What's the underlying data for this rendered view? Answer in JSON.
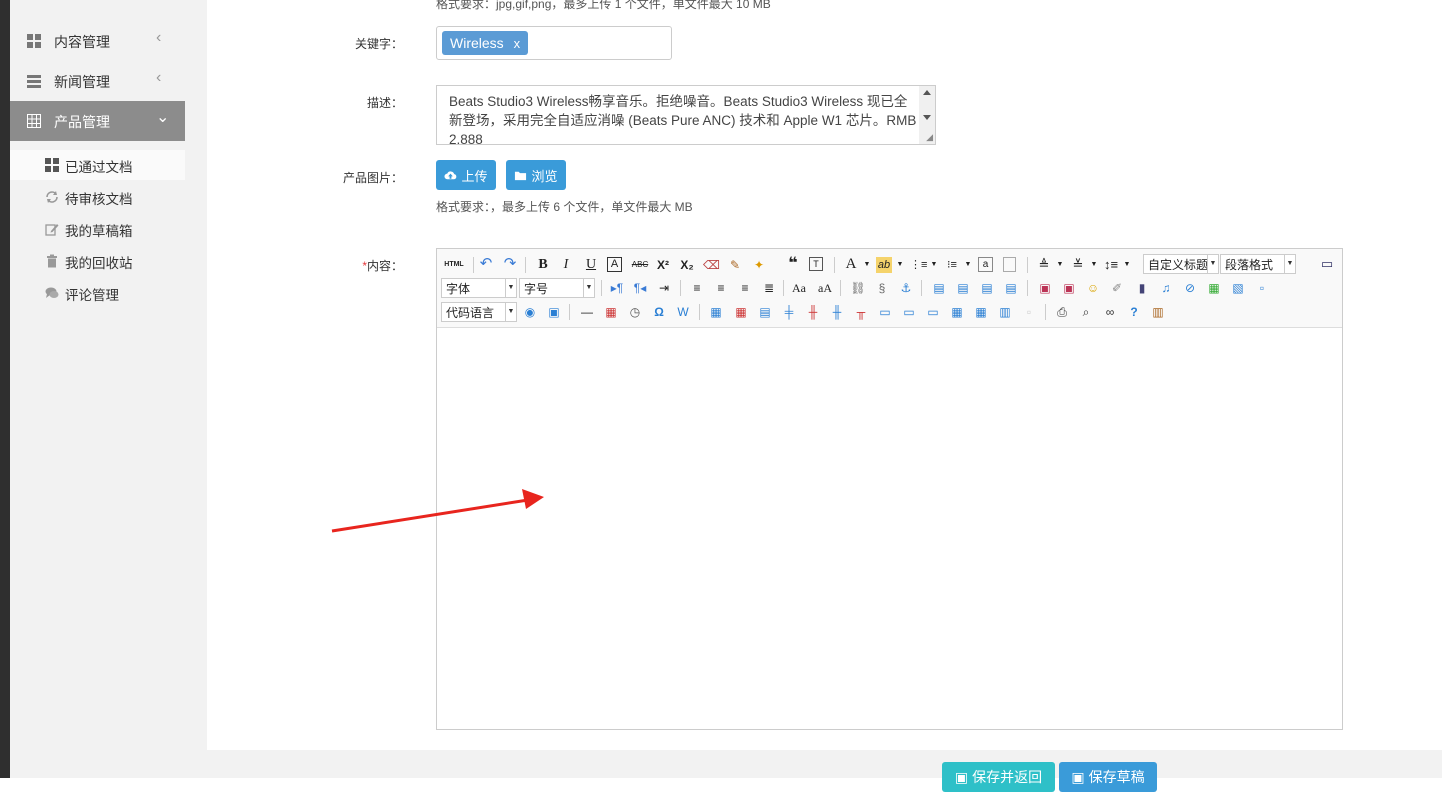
{
  "sidebar": {
    "menus": [
      {
        "label": "内容管理",
        "icon": "grid-icon",
        "chevron": "‹"
      },
      {
        "label": "新闻管理",
        "icon": "list-icon",
        "chevron": "‹"
      },
      {
        "label": "产品管理",
        "icon": "table-icon",
        "chevron": "⌄"
      }
    ],
    "sub_items": [
      {
        "label": "已通过文档",
        "icon": "grid-icon"
      },
      {
        "label": "待审核文档",
        "icon": "refresh-icon"
      },
      {
        "label": "我的草稿箱",
        "icon": "edit-icon"
      },
      {
        "label": "我的回收站",
        "icon": "trash-icon"
      },
      {
        "label": "评论管理",
        "icon": "comments-icon"
      }
    ]
  },
  "form": {
    "top_note": "格式要求：jpg,gif,png，最多上传 1 个文件，单文件最大 10 MB",
    "keywords_label": "关键字：",
    "keyword_tag": "Wireless",
    "keyword_remove": "x",
    "desc_label": "描述：",
    "desc_value": "Beats Studio3 Wireless畅享音乐。拒绝噪音。Beats Studio3 Wireless 现已全新登场，采用完全自适应消噪 (Beats Pure ANC) 技术和 Apple W1 芯片。RMB 2,888",
    "image_label": "产品图片：",
    "upload_label": "上传",
    "browse_label": "浏览",
    "image_note": "格式要求：，最多上传 6 个文件，单文件最大 MB",
    "content_required": "*",
    "content_label": "内容："
  },
  "editor": {
    "html_label": "HTML",
    "custom_title_select": "自定义标题",
    "paragraph_select": "段落格式",
    "font_select": "字体",
    "size_select": "字号",
    "code_lang_select": "代码语言"
  },
  "bottom_buttons": {
    "save_return": "保存并返回",
    "save_draft": "保存草稿"
  },
  "colors": {
    "accent": "#3a9bd9",
    "tag": "#5b9bd5",
    "active_menu": "#8c8c8c",
    "save_return_bg": "#2ec0c8",
    "arrow": "#e8251e"
  }
}
